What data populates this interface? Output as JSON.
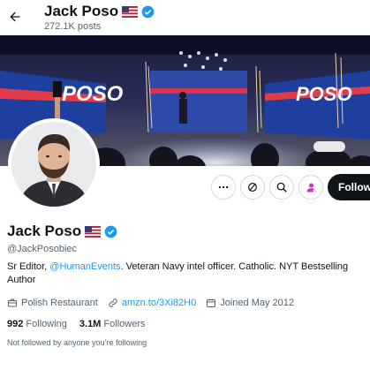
{
  "header": {
    "name": "Jack Poso",
    "post_count": "272.1K posts"
  },
  "profile": {
    "name": "Jack Poso",
    "handle": "@JackPosobiec",
    "bio_before": "Sr Editor, ",
    "bio_mention": "@HumanEvents",
    "bio_after": ". Veteran Navy intel officer. Catholic. NYT Bestselling Author",
    "category": "Polish Restaurant",
    "link": "amzn.to/3Xi82H0",
    "joined": "Joined May 2012",
    "following_count": "992",
    "following_label": "Following",
    "followers_count": "3.1M",
    "followers_label": "Followers",
    "not_followed_note": "Not followed by anyone you’re following"
  },
  "banner": {
    "logo_left": "POSO",
    "logo_right": "POSO"
  },
  "actions": {
    "follow_label": "Follow"
  },
  "icons": {
    "back": "arrow-left-icon",
    "verified": "verified-badge-icon",
    "flag": "us-flag-icon",
    "more": "more-icon",
    "notify": "notification-icon",
    "search": "search-icon",
    "subscribe": "subscribe-icon",
    "category": "briefcase-icon",
    "link": "link-icon",
    "calendar": "calendar-icon"
  },
  "colors": {
    "accent": "#1d9bf0",
    "text": "#0f1419",
    "secondary": "#536471",
    "follow_bg": "#0f1419",
    "subscribe": "#c936cc"
  }
}
